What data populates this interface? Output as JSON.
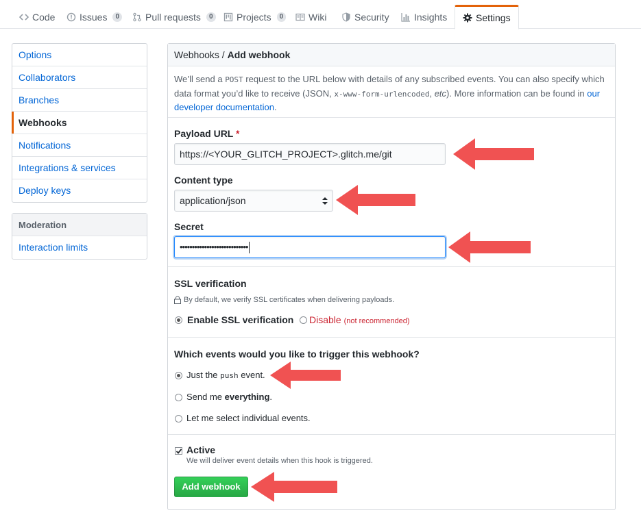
{
  "nav": {
    "tabs": [
      {
        "label": "Code",
        "icon": "code-icon"
      },
      {
        "label": "Issues",
        "count": "0",
        "icon": "issue-icon"
      },
      {
        "label": "Pull requests",
        "count": "0",
        "icon": "pull-request-icon"
      },
      {
        "label": "Projects",
        "count": "0",
        "icon": "project-icon"
      },
      {
        "label": "Wiki",
        "icon": "book-icon"
      },
      {
        "label": "Security",
        "icon": "shield-icon"
      },
      {
        "label": "Insights",
        "icon": "graph-icon"
      },
      {
        "label": "Settings",
        "icon": "gear-icon",
        "selected": true
      }
    ]
  },
  "sidebar": {
    "items": [
      "Options",
      "Collaborators",
      "Branches",
      "Webhooks",
      "Notifications",
      "Integrations & services",
      "Deploy keys"
    ],
    "selected": "Webhooks",
    "moderation": {
      "heading": "Moderation",
      "items": [
        "Interaction limits"
      ]
    }
  },
  "panel": {
    "breadcrumb_parent": "Webhooks",
    "breadcrumb_sep": " / ",
    "title": "Add webhook",
    "intro": {
      "t1": "We’ll send a ",
      "code1": "POST",
      "t2": " request to the URL below with details of any subscribed events. You can also specify which data format you’d like to receive (JSON, ",
      "code2": "x-www-form-urlencoded",
      "t3": ", ",
      "em": "etc",
      "t4": "). More information can be found in ",
      "link": "our developer documentation",
      "t5": "."
    },
    "payload_url": {
      "label": "Payload URL",
      "required_mark": "*",
      "value": "https://<YOUR_GLITCH_PROJECT>.glitch.me/git"
    },
    "content_type": {
      "label": "Content type",
      "value": "application/json"
    },
    "secret": {
      "label": "Secret",
      "value": "••••••••••••••••••••••••••••"
    },
    "ssl": {
      "heading": "SSL verification",
      "note": "By default, we verify SSL certificates when delivering payloads.",
      "enable_label": "Enable SSL verification",
      "disable_label": "Disable",
      "disable_note": "(not recommended)"
    },
    "events": {
      "heading": "Which events would you like to trigger this webhook?",
      "push_pre": "Just the ",
      "push_code": "push",
      "push_post": " event.",
      "everything_pre": "Send me ",
      "everything_bold": "everything",
      "everything_post": ".",
      "individual": "Let me select individual events."
    },
    "active": {
      "label": "Active",
      "note": "We will deliver event details when this hook is triggered."
    },
    "submit_label": "Add webhook"
  },
  "colors": {
    "accent": "#e36209",
    "link": "#0366d6",
    "primary_button": "#28a745",
    "annotation_arrow": "#f05252",
    "danger": "#cb2431"
  }
}
